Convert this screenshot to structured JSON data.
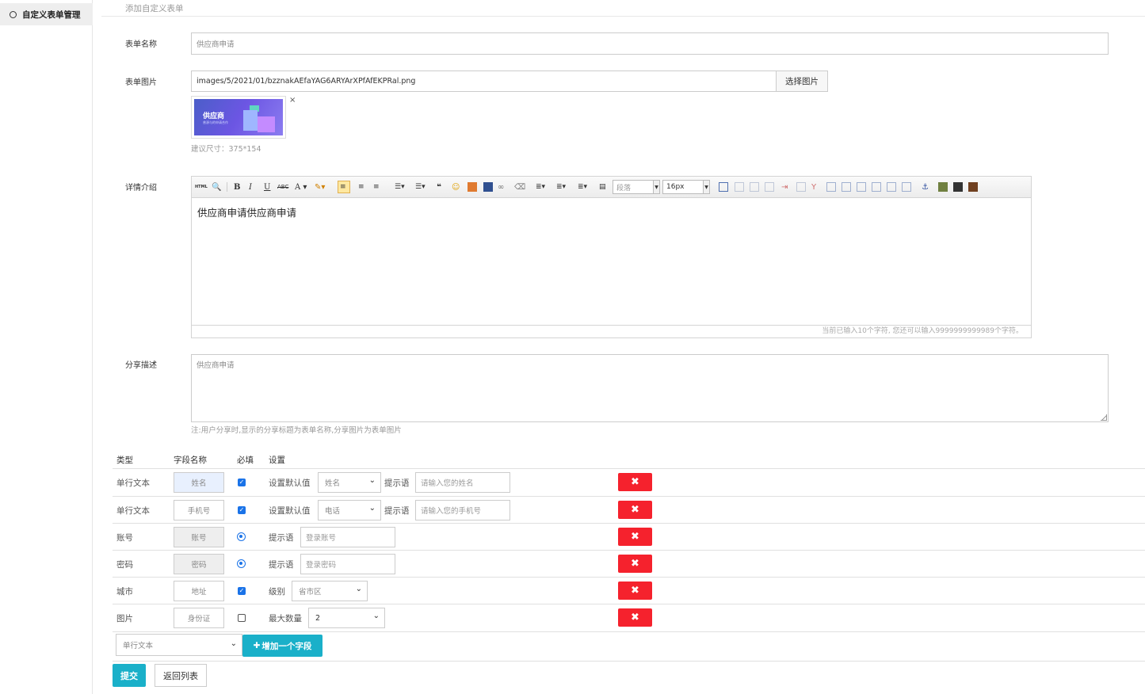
{
  "sidebar": {
    "items": [
      {
        "label": "自定义表单管理"
      }
    ]
  },
  "breadcrumb": "添加自定义表单",
  "form": {
    "name_label": "表单名称",
    "name_value": "供应商申请",
    "image_label": "表单图片",
    "image_value": "images/5/2021/01/bzznakAEfaYAG6ARYArXPfAfEKPRal.png",
    "image_button": "选择图片",
    "image_delete": "×",
    "image_title": "供应商",
    "image_subtitle": "普源与的申请合作",
    "image_hint": "建议尺寸：375*154",
    "detail_label": "详情介绍",
    "editor": {
      "para_select": "段落",
      "size_select": "16px",
      "content": "供应商申请供应商申请",
      "footer": "当前已输入10个字符, 您还可以输入9999999999989个字符。"
    },
    "share_label": "分享描述",
    "share_value": "供应商申请",
    "share_hint": "注:用户分享时,显示的分享标题为表单名称,分享图片为表单图片"
  },
  "fields_table": {
    "headers": {
      "type": "类型",
      "name": "字段名称",
      "required": "必填",
      "settings": "设置"
    },
    "rows": [
      {
        "type": "单行文本",
        "name": "姓名",
        "setting_label": "设置默认值",
        "select": "姓名",
        "tip_label": "提示语",
        "tip": "请输入您的姓名"
      },
      {
        "type": "单行文本",
        "name": "手机号",
        "setting_label": "设置默认值",
        "select": "电话",
        "tip_label": "提示语",
        "tip": "请输入您的手机号"
      },
      {
        "type": "账号",
        "name": "账号",
        "tip_label": "提示语",
        "tip": "登录账号"
      },
      {
        "type": "密码",
        "name": "密码",
        "tip_label": "提示语",
        "tip": "登录密码"
      },
      {
        "type": "城市",
        "name": "地址",
        "setting_label": "级别",
        "select": "省市区"
      },
      {
        "type": "图片",
        "name": "身份证",
        "setting_label": "最大数量",
        "select": "2"
      }
    ],
    "delete_icon": "✖"
  },
  "add": {
    "select": "单行文本",
    "button": "增加一个字段",
    "button_icon": "✚"
  },
  "actions": {
    "submit": "提交",
    "back": "返回列表"
  }
}
